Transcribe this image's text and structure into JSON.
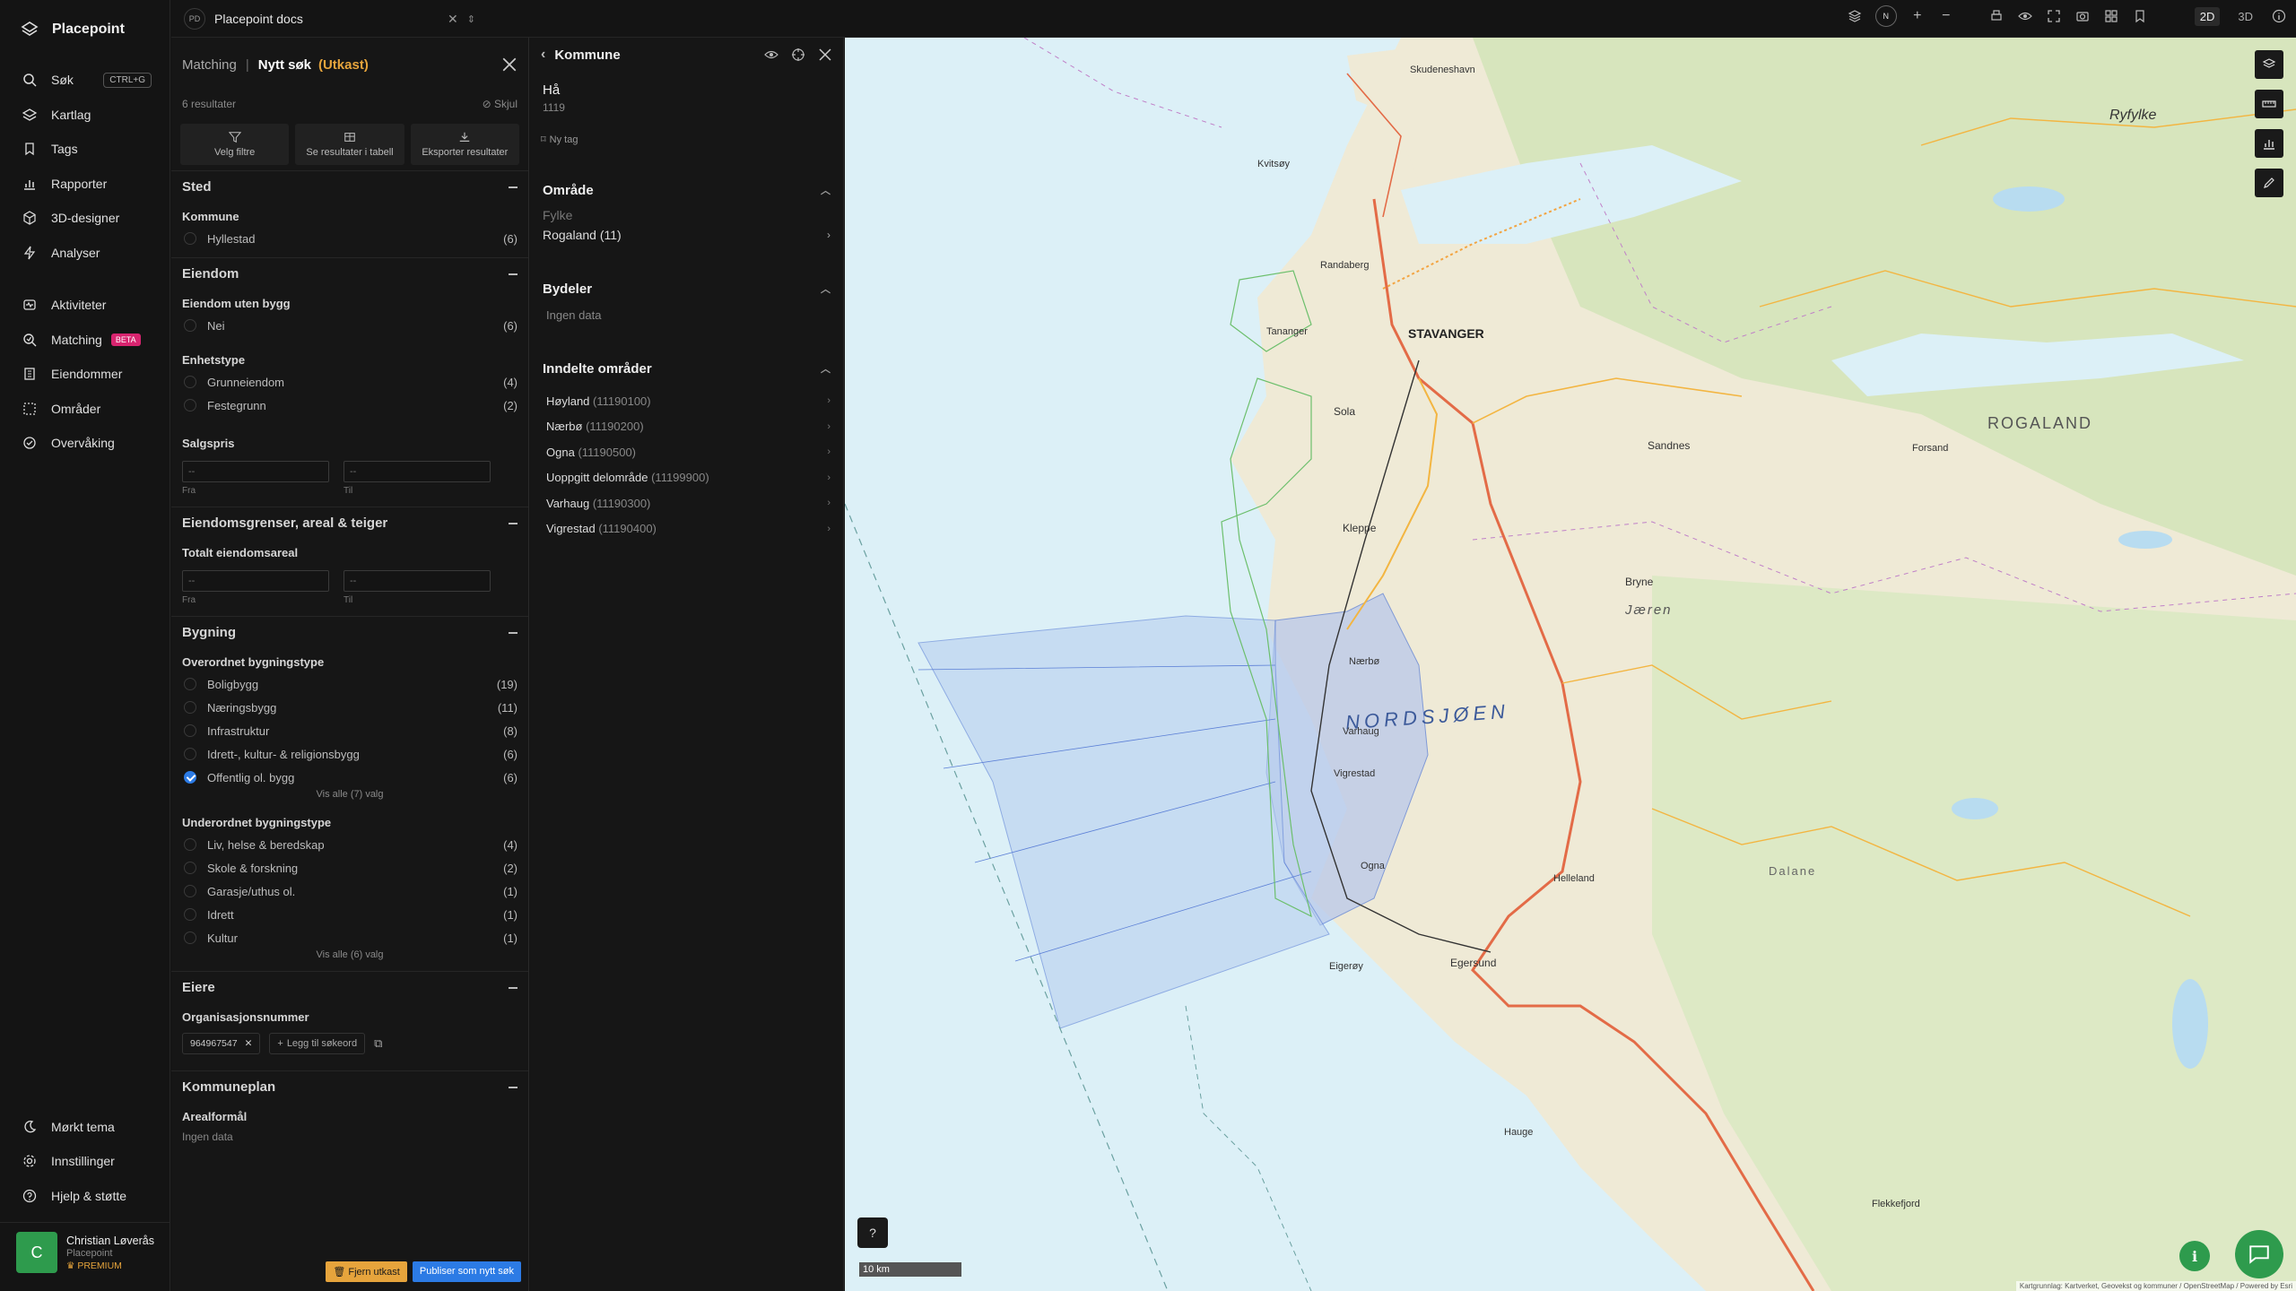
{
  "app": {
    "name": "Placepoint"
  },
  "nav": {
    "items": [
      {
        "label": "Søk",
        "icon": "search-icon",
        "shortcut": "CTRL+G"
      },
      {
        "label": "Kartlag",
        "icon": "layers-icon"
      },
      {
        "label": "Tags",
        "icon": "bookmark-icon"
      },
      {
        "label": "Rapporter",
        "icon": "chart-icon"
      },
      {
        "label": "3D-designer",
        "icon": "cube-icon"
      },
      {
        "label": "Analyser",
        "icon": "bolt-icon"
      }
    ],
    "items2": [
      {
        "label": "Aktiviteter",
        "icon": "activity-icon"
      },
      {
        "label": "Matching",
        "icon": "match-icon",
        "badge": "BETA"
      },
      {
        "label": "Eiendommer",
        "icon": "building-icon"
      },
      {
        "label": "Områder",
        "icon": "area-icon"
      },
      {
        "label": "Overvåking",
        "icon": "monitor-icon"
      }
    ],
    "bottom": [
      {
        "label": "Mørkt tema",
        "icon": "moon-icon"
      },
      {
        "label": "Innstillinger",
        "icon": "gear-icon"
      },
      {
        "label": "Hjelp & støtte",
        "icon": "help-icon"
      }
    ],
    "user": {
      "initial": "C",
      "name": "Christian Løverås",
      "org": "Placepoint",
      "plan": "PREMIUM"
    }
  },
  "topbar": {
    "workspace_badge": "PD",
    "workspace": "Placepoint docs",
    "compass": "N",
    "mode_2d": "2D",
    "mode_3d": "3D"
  },
  "filters": {
    "crumb": "Matching",
    "title": "Nytt søk",
    "draft": "(Utkast)",
    "results": "6 resultater",
    "hide": "Skjul",
    "actions": [
      "Velg filtre",
      "Se resultater i tabell",
      "Eksporter resultater"
    ],
    "sted": {
      "title": "Sted",
      "group": "Kommune",
      "options": [
        {
          "label": "Hyllestad",
          "count": "(6)"
        }
      ]
    },
    "eiendom": {
      "title": "Eiendom",
      "group1": "Eiendom uten bygg",
      "options1": [
        {
          "label": "Nei",
          "count": "(6)"
        }
      ],
      "group2": "Enhetstype",
      "options2": [
        {
          "label": "Grunneiendom",
          "count": "(4)"
        },
        {
          "label": "Festegrunn",
          "count": "(2)"
        }
      ],
      "group3": "Salgspris",
      "from_placeholder": "--",
      "to_placeholder": "--",
      "from_label": "Fra",
      "to_label": "Til"
    },
    "grenser": {
      "title": "Eiendomsgrenser, areal & teiger",
      "group": "Totalt eiendomsareal",
      "from_placeholder": "--",
      "to_placeholder": "--",
      "from_label": "Fra",
      "to_label": "Til"
    },
    "bygning": {
      "title": "Bygning",
      "group1": "Overordnet bygningstype",
      "options1": [
        {
          "label": "Boligbygg",
          "count": "(19)"
        },
        {
          "label": "Næringsbygg",
          "count": "(11)"
        },
        {
          "label": "Infrastruktur",
          "count": "(8)"
        },
        {
          "label": "Idrett-, kultur- & religionsbygg",
          "count": "(6)"
        },
        {
          "label": "Offentlig ol. bygg",
          "count": "(6)"
        }
      ],
      "show_all1": "Vis alle (7) valg",
      "group2": "Underordnet bygningstype",
      "options2": [
        {
          "label": "Liv, helse & beredskap",
          "count": "(4)"
        },
        {
          "label": "Skole & forskning",
          "count": "(2)"
        },
        {
          "label": "Garasje/uthus ol.",
          "count": "(1)"
        },
        {
          "label": "Idrett",
          "count": "(1)"
        },
        {
          "label": "Kultur",
          "count": "(1)"
        }
      ],
      "show_all2": "Vis alle (6) valg"
    },
    "eiere": {
      "title": "Eiere",
      "group": "Organisasjonsnummer",
      "tag": "964967547",
      "add": "Legg til søkeord"
    },
    "kommuneplan": {
      "title": "Kommuneplan",
      "group": "Arealformål",
      "nodata": "Ingen data"
    },
    "remove_draft": "Fjern utkast",
    "publish": "Publiser som nytt søk"
  },
  "kommune": {
    "header": "Kommune",
    "name": "Hå",
    "code": "1119",
    "new_tag": "Ny tag",
    "omrade": {
      "title": "Område",
      "label": "Fylke",
      "value": "Rogaland",
      "value_count": "(11)"
    },
    "bydeler": {
      "title": "Bydeler",
      "nodata": "Ingen data"
    },
    "inndelte": {
      "title": "Inndelte områder",
      "items": [
        {
          "name": "Høyland",
          "code": "(11190100)"
        },
        {
          "name": "Nærbø",
          "code": "(11190200)"
        },
        {
          "name": "Ogna",
          "code": "(11190500)"
        },
        {
          "name": "Uoppgitt delområde",
          "code": "(11199900)"
        },
        {
          "name": "Varhaug",
          "code": "(11190300)"
        },
        {
          "name": "Vigrestad",
          "code": "(11190400)"
        }
      ]
    }
  },
  "map": {
    "labels": {
      "sea": "NORDSJØEN",
      "region": "ROGALAND",
      "ryfylke": "Ryfylke",
      "stavanger": "STAVANGER",
      "jaeren": "Jæren",
      "sandnes": "Sandnes",
      "egersund": "Egersund",
      "bryne": "Bryne",
      "narbo": "Nærbø",
      "varhaug": "Varhaug",
      "vigrestad": "Vigrestad",
      "ogna": "Ogna",
      "kleppe": "Kleppe",
      "sola": "Sola",
      "skudenes": "Skudeneshavn",
      "eigeroy": "Eigerøy",
      "hauge": "Hauge",
      "forsand": "Forsand",
      "flekkefjord": "Flekkefjord",
      "helleland": "Helleland",
      "dalane": "Dalane",
      "tananger": "Tananger",
      "kvitsoy": "Kvitsøy",
      "randaberg": "Randaberg"
    },
    "scale": "10 km",
    "attribution": "Kartgrunnlag: Kartverket, Geovekst og kommuner / OpenStreetMap / Powered by Esri",
    "colors": {
      "sea": "#dcf0f7",
      "land": "#efead6",
      "forest": "#cfe3b4",
      "road": "#e36b47",
      "polygon": "#5b7fd6"
    }
  }
}
